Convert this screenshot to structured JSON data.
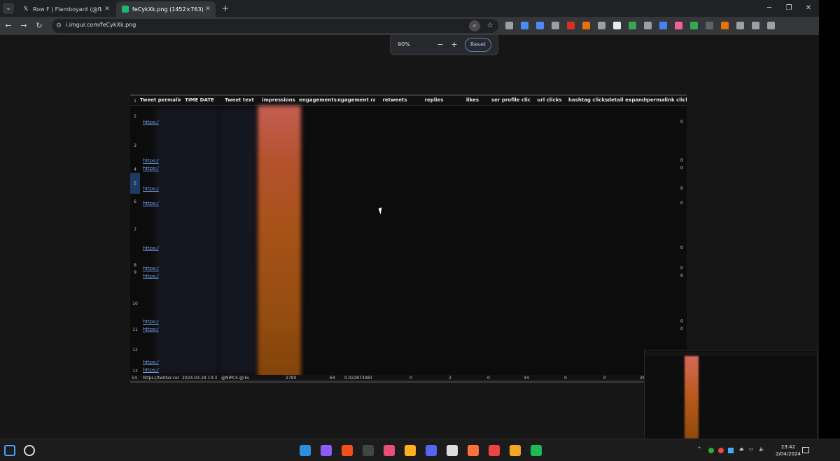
{
  "browser": {
    "tabs": [
      {
        "title": "Row F | Flamboyant (@flamboy",
        "icon": "x-logo-icon"
      },
      {
        "title": "feCykXk.png (1452×763)",
        "icon": "imgur-icon"
      }
    ],
    "url": "i.imgur.com/feCykXk.png",
    "zoom": {
      "level": "90%",
      "minus": "−",
      "plus": "+",
      "reset": "Reset"
    },
    "extension_colors": [
      "#9aa0a6",
      "#4c8bf5",
      "#4c8bf5",
      "#9aa0a6",
      "#d93025",
      "#e8710a",
      "#9aa0a6",
      "#e8eaed",
      "#34a853",
      "#9aa0a6",
      "#4285f4",
      "#f06292",
      "#34a853",
      "#5f6368",
      "#e8710a",
      "#9aa0a6",
      "#9aa0a6",
      "#9aa0a6"
    ]
  },
  "sheet": {
    "headers": [
      "Tweet permalink",
      "TIME DATE",
      "Tweet text",
      "impressions",
      "engagements",
      "engagement rate",
      "retweets",
      "replies",
      "likes",
      "user profile clicks",
      "url clicks",
      "hashtag clicks",
      "detail expands",
      "permalink clicks"
    ],
    "header_display": [
      "Tweet permalink",
      "TIME DATE",
      "Tweet text",
      "impressions",
      "engagements",
      "ngagement rat",
      "retweets",
      "replies",
      "likes",
      "ser profile click",
      "url clicks",
      "hashtag clicks",
      "detail expands",
      "permalink clicks"
    ],
    "row_numbers": [
      "1",
      "2",
      "3",
      "4",
      "5",
      "6",
      "7",
      "8",
      "9",
      "10",
      "11",
      "12",
      "13",
      "14"
    ],
    "links": [
      "https:/",
      "https:/",
      "https:/",
      "https:/",
      "https:/",
      "https:/",
      "https:/",
      "https:/",
      "https:/",
      "https:/",
      "https:/",
      "https:/"
    ],
    "zeros": [
      "0",
      "0",
      "0",
      "0",
      "0",
      "0",
      "0",
      "0",
      "0",
      "0",
      "0",
      "0"
    ],
    "last_row": {
      "num": "14",
      "permalink": "https://twitter.cor",
      "time": "2024-03-24 13:3",
      "text": "@NIPCS @iks",
      "impressions": "2790",
      "engagements": "64",
      "rate": "0.022873481",
      "retweets": "0",
      "replies": "2",
      "likes": "0",
      "profile_clicks": "34",
      "url_clicks": "0",
      "hashtag_clicks": "0",
      "detail_expands": "28"
    },
    "colors": {
      "link": "#6e9ee8",
      "selected_row": "#1e3a66",
      "impressions_band_top": "#d9685a",
      "impressions_band_bottom": "#8f4a0c"
    }
  },
  "taskbar": {
    "apps": [
      "windows-start-icon",
      "search-icon",
      "file-explorer-icon",
      "vscode-icon",
      "obsidian-icon",
      "figma-icon",
      "terminal-icon",
      "app-icon",
      "discord-icon",
      "capcut-icon",
      "firefox-icon",
      "chrome-icon",
      "arrow-app-icon",
      "spotify-icon"
    ],
    "time": "23:42",
    "date": "2/04/2024",
    "tray_chevron": "^"
  }
}
